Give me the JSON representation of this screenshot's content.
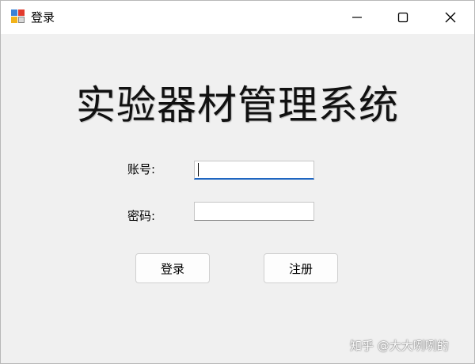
{
  "window": {
    "title": "登录",
    "controls": [
      "minimize-icon",
      "maximize-icon",
      "close-icon"
    ]
  },
  "heading": "实验器材管理系统",
  "form": {
    "account_label": "账号:",
    "account_value": "",
    "password_label": "密码:",
    "password_value": ""
  },
  "buttons": {
    "login": "登录",
    "register": "注册"
  },
  "watermark": "知乎 @大大咧咧的",
  "colors": {
    "title_bg": "#ffffff",
    "window_bg": "#f0f0f0",
    "focus_accent": "#1f66c1"
  }
}
